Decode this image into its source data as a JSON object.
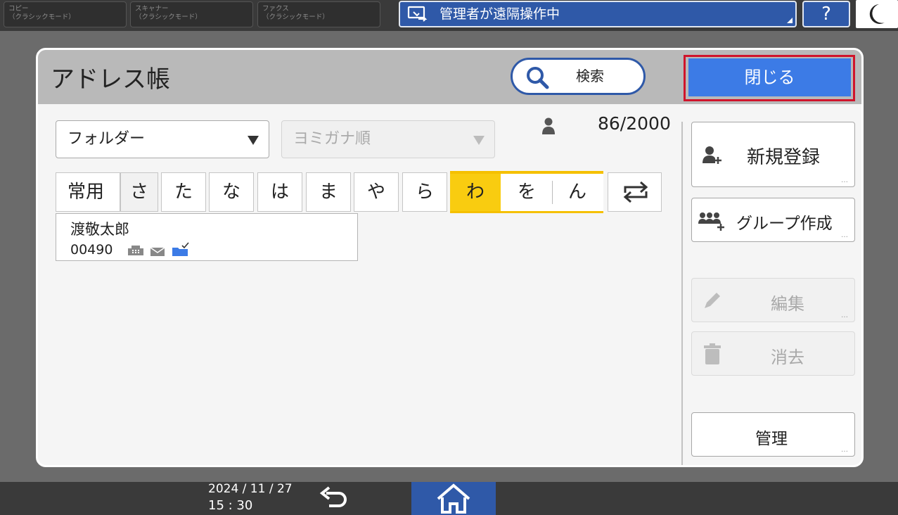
{
  "topbar": {
    "mode_tabs": [
      {
        "line1": "コピー",
        "line2": "（クラシックモード）"
      },
      {
        "line1": "スキャナー",
        "line2": "（クラシックモード）"
      },
      {
        "line1": "ファクス",
        "line2": "（クラシックモード）"
      }
    ],
    "remote_status": "管理者が遠隔操作中",
    "help_label": "?",
    "icons": {
      "remote": "remote-operation-icon",
      "sleep": "moon-icon"
    }
  },
  "dialog": {
    "title": "アドレス帳",
    "search_label": "検索",
    "close_label": "閉じる",
    "folder_dropdown": "フォルダー",
    "sort_dropdown": "ヨミガナ順",
    "entry_count": "86/2000",
    "index_tabs": [
      "常用",
      "さ",
      "た",
      "な",
      "は",
      "ま",
      "や",
      "ら"
    ],
    "index_group": {
      "selected": "わ",
      "others": [
        "を",
        "ん"
      ]
    },
    "entries": [
      {
        "name": "渡敬太郎",
        "number": "00490",
        "icons": [
          "fax-icon",
          "mail-icon",
          "folder-icon"
        ]
      }
    ],
    "side_buttons": {
      "register": "新規登録",
      "group": "グループ作成",
      "edit": "編集",
      "delete": "消去",
      "manage": "管理"
    }
  },
  "bottombar": {
    "date": "2024 / 11 / 27",
    "time": "15 : 30"
  },
  "colors": {
    "accent_blue": "#3c7be6",
    "dark_blue": "#2f59a8",
    "highlight_red": "#d0142b",
    "tab_selected_yellow": "#f9cc10"
  }
}
